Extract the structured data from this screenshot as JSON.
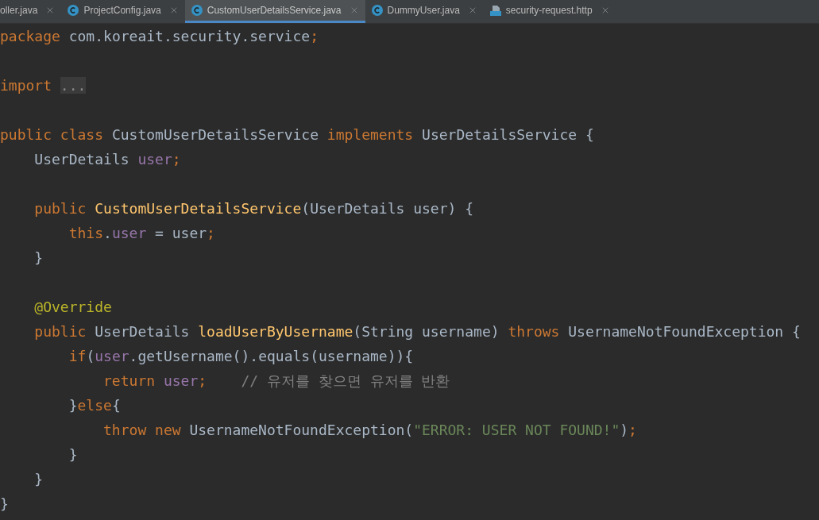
{
  "tabs": [
    {
      "label": "oller.java",
      "kind": "none",
      "selected": false
    },
    {
      "label": "ProjectConfig.java",
      "kind": "class",
      "selected": false
    },
    {
      "label": "CustomUserDetailsService.java",
      "kind": "class",
      "selected": true
    },
    {
      "label": "DummyUser.java",
      "kind": "class",
      "selected": false
    },
    {
      "label": "security-request.http",
      "kind": "api",
      "selected": false
    }
  ],
  "code_lines": [
    {
      "kind": "code",
      "tokens": [
        {
          "kind": "keyword",
          "text": "package"
        },
        {
          "kind": "plain",
          "text": " com.koreait.security.service"
        },
        {
          "kind": "keyword",
          "text": ";"
        }
      ]
    },
    {
      "kind": "blank"
    },
    {
      "kind": "code",
      "tokens": [
        {
          "kind": "keyword",
          "text": "import "
        },
        {
          "kind": "fold",
          "text": "..."
        }
      ]
    },
    {
      "kind": "blank"
    },
    {
      "kind": "code",
      "tokens": [
        {
          "kind": "keyword",
          "text": "public class "
        },
        {
          "kind": "plain",
          "text": "CustomUserDetailsService "
        },
        {
          "kind": "keyword",
          "text": "implements "
        },
        {
          "kind": "plain",
          "text": "UserDetailsService {"
        }
      ],
      "children": [
        {
          "kind": "code",
          "tokens": [
            {
              "kind": "plain",
              "text": "UserDetails "
            },
            {
              "kind": "field",
              "text": "user"
            },
            {
              "kind": "keyword",
              "text": ";"
            }
          ]
        },
        {
          "kind": "blank"
        },
        {
          "kind": "code",
          "tokens": [
            {
              "kind": "keyword",
              "text": "public "
            },
            {
              "kind": "method",
              "text": "CustomUserDetailsService"
            },
            {
              "kind": "plain",
              "text": "(UserDetails user) {"
            }
          ],
          "children": [
            {
              "kind": "code",
              "tokens": [
                {
                  "kind": "keyword",
                  "text": "this"
                },
                {
                  "kind": "plain",
                  "text": "."
                },
                {
                  "kind": "field",
                  "text": "user"
                },
                {
                  "kind": "plain",
                  "text": " = user"
                },
                {
                  "kind": "keyword",
                  "text": ";"
                }
              ]
            }
          ]
        },
        {
          "kind": "code",
          "tokens": [
            {
              "kind": "plain",
              "text": "}"
            }
          ]
        },
        {
          "kind": "blank"
        },
        {
          "kind": "code",
          "tokens": [
            {
              "kind": "annotation",
              "text": "@Override"
            }
          ]
        },
        {
          "kind": "code",
          "tokens": [
            {
              "kind": "keyword",
              "text": "public "
            },
            {
              "kind": "plain",
              "text": "UserDetails "
            },
            {
              "kind": "method",
              "text": "loadUserByUsername"
            },
            {
              "kind": "plain",
              "text": "(String username) "
            },
            {
              "kind": "keyword",
              "text": "throws "
            },
            {
              "kind": "plain",
              "text": "UsernameNotFoundException {"
            }
          ],
          "children": [
            {
              "kind": "code",
              "tokens": [
                {
                  "kind": "keyword",
                  "text": "if"
                },
                {
                  "kind": "plain",
                  "text": "("
                },
                {
                  "kind": "field",
                  "text": "user"
                },
                {
                  "kind": "plain",
                  "text": ".getUsername().equals(username)){"
                }
              ],
              "children": [
                {
                  "kind": "code",
                  "tokens": [
                    {
                      "kind": "keyword",
                      "text": "return "
                    },
                    {
                      "kind": "field",
                      "text": "user"
                    },
                    {
                      "kind": "keyword",
                      "text": ";"
                    },
                    {
                      "kind": "comment",
                      "text": "    // 유저를 찾으면 유저를 반환"
                    }
                  ]
                }
              ]
            },
            {
              "kind": "code",
              "tokens": [
                {
                  "kind": "plain",
                  "text": "}"
                },
                {
                  "kind": "keyword",
                  "text": "else"
                },
                {
                  "kind": "plain",
                  "text": "{"
                }
              ],
              "children": [
                {
                  "kind": "code",
                  "tokens": [
                    {
                      "kind": "keyword",
                      "text": "throw new "
                    },
                    {
                      "kind": "plain",
                      "text": "UsernameNotFoundException("
                    },
                    {
                      "kind": "string",
                      "text": "\"ERROR: USER NOT FOUND!\""
                    },
                    {
                      "kind": "plain",
                      "text": ")"
                    },
                    {
                      "kind": "keyword",
                      "text": ";"
                    }
                  ]
                }
              ]
            },
            {
              "kind": "code",
              "tokens": [
                {
                  "kind": "plain",
                  "text": "}"
                }
              ]
            }
          ]
        },
        {
          "kind": "code",
          "tokens": [
            {
              "kind": "plain",
              "text": "}"
            }
          ]
        }
      ]
    },
    {
      "kind": "code",
      "tokens": [
        {
          "kind": "plain",
          "text": "}"
        }
      ]
    }
  ]
}
